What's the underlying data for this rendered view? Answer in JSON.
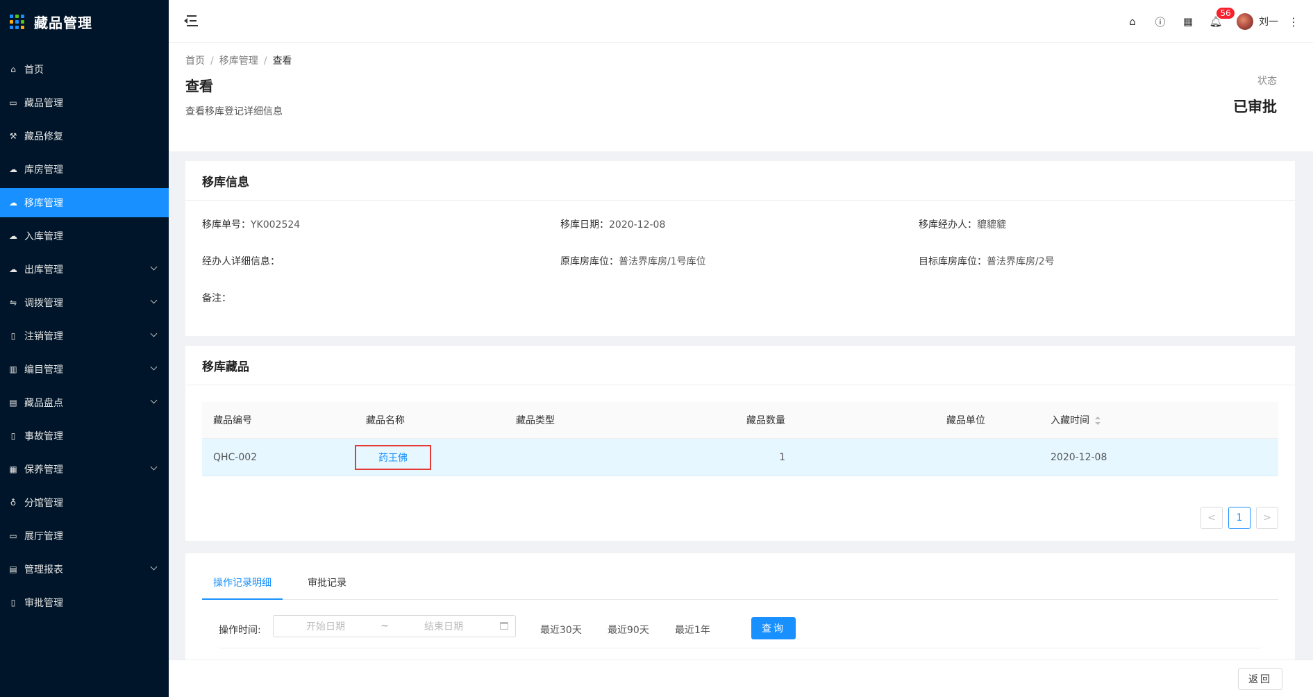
{
  "app": {
    "title": "藏品管理"
  },
  "sidebar": {
    "items": [
      {
        "label": "首页",
        "icon": "home-icon",
        "glyph": "⌂",
        "expandable": false
      },
      {
        "label": "藏品管理",
        "icon": "calendar-icon",
        "glyph": "▭",
        "expandable": false
      },
      {
        "label": "藏品修复",
        "icon": "wrench-icon",
        "glyph": "⚒",
        "expandable": false
      },
      {
        "label": "库房管理",
        "icon": "cloud-icon",
        "glyph": "☁",
        "expandable": false
      },
      {
        "label": "移库管理",
        "icon": "cloud-icon",
        "glyph": "☁",
        "expandable": false,
        "active": true
      },
      {
        "label": "入库管理",
        "icon": "cloud-upload-icon",
        "glyph": "☁",
        "expandable": false
      },
      {
        "label": "出库管理",
        "icon": "cloud-download-icon",
        "glyph": "☁",
        "expandable": true
      },
      {
        "label": "调拨管理",
        "icon": "transfer-icon",
        "glyph": "⇋",
        "expandable": true
      },
      {
        "label": "注销管理",
        "icon": "file-icon",
        "glyph": "▯",
        "expandable": true
      },
      {
        "label": "编目管理",
        "icon": "book-icon",
        "glyph": "▥",
        "expandable": true
      },
      {
        "label": "藏品盘点",
        "icon": "calendar-icon",
        "glyph": "▤",
        "expandable": true
      },
      {
        "label": "事故管理",
        "icon": "file-search-icon",
        "glyph": "▯",
        "expandable": false
      },
      {
        "label": "保养管理",
        "icon": "bank-icon",
        "glyph": "▦",
        "expandable": true
      },
      {
        "label": "分馆管理",
        "icon": "cluster-icon",
        "glyph": "♁",
        "expandable": false
      },
      {
        "label": "展厅管理",
        "icon": "laptop-icon",
        "glyph": "▭",
        "expandable": false
      },
      {
        "label": "管理报表",
        "icon": "report-icon",
        "glyph": "▤",
        "expandable": true
      },
      {
        "label": "审批管理",
        "icon": "audit-icon",
        "glyph": "▯",
        "expandable": false
      }
    ]
  },
  "header": {
    "notification_count": "56",
    "user_name": "刘一"
  },
  "breadcrumb": {
    "items": [
      "首页",
      "移库管理",
      "查看"
    ]
  },
  "page": {
    "title": "查看",
    "description": "查看移库登记详细信息",
    "status_label": "状态",
    "status_value": "已审批"
  },
  "transfer_info": {
    "title": "移库信息",
    "fields": [
      {
        "label": "移库单号：",
        "value": "YK002524"
      },
      {
        "label": "移库日期：",
        "value": "2020-12-08"
      },
      {
        "label": "移库经办人：",
        "value": "貔貔貔"
      },
      {
        "label": "经办人详细信息：",
        "value": ""
      },
      {
        "label": "原库房库位：",
        "value": "普法界库房/1号库位"
      },
      {
        "label": "目标库房库位：",
        "value": "普法界库房/2号"
      },
      {
        "label": "备注：",
        "value": ""
      }
    ]
  },
  "collection": {
    "title": "移库藏品",
    "columns": [
      "藏品编号",
      "藏品名称",
      "藏品类型",
      "藏品数量",
      "藏品单位",
      "入藏时间"
    ],
    "rows": [
      {
        "id": "QHC-002",
        "name": "药王佛",
        "type": "",
        "quantity": "1",
        "unit": "",
        "date": "2020-12-08"
      }
    ],
    "pagination": {
      "current": "1",
      "prev": "<",
      "next": ">"
    }
  },
  "records": {
    "tabs": [
      "操作记录明细",
      "审批记录"
    ],
    "filter": {
      "label": "操作时间:",
      "start_placeholder": "开始日期",
      "separator": "~",
      "end_placeholder": "结束日期",
      "quick": [
        "最近30天",
        "最近90天",
        "最近1年"
      ],
      "query_label": "查询"
    }
  },
  "footer": {
    "back_label": "返回"
  }
}
